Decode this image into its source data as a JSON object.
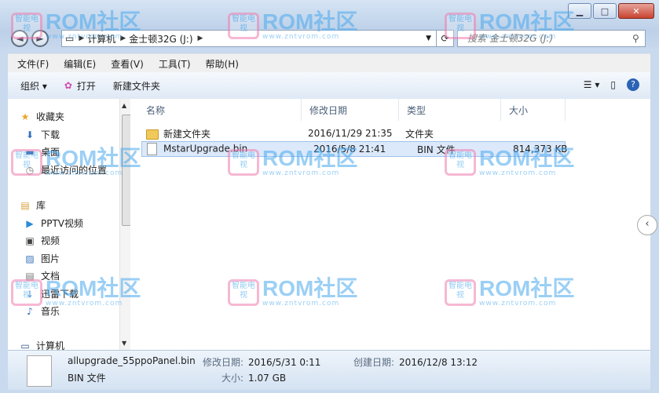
{
  "nav": {
    "back": "◄",
    "forward": "►"
  },
  "address": {
    "segments": [
      "计算机",
      "金士顿32G (J:)"
    ],
    "dropdown": "▼",
    "refresh": "⟳"
  },
  "search": {
    "placeholder": "搜索 金士顿32G (J:)"
  },
  "menu": [
    "文件(F)",
    "编辑(E)",
    "查看(V)",
    "工具(T)",
    "帮助(H)"
  ],
  "toolbar": {
    "organize": "组织 ▾",
    "open": "打开",
    "new_folder": "新建文件夹"
  },
  "sidebar": {
    "items": [
      {
        "label": "收藏夹",
        "icon": "★"
      },
      {
        "label": "下载",
        "icon": "⬇"
      },
      {
        "label": "桌面",
        "icon": "▬"
      },
      {
        "label": "最近访问的位置",
        "icon": "◷"
      },
      {
        "label": "库",
        "icon": "▤"
      },
      {
        "label": "PPTV视频",
        "icon": "▶"
      },
      {
        "label": "视频",
        "icon": "▣"
      },
      {
        "label": "图片",
        "icon": "▨"
      },
      {
        "label": "文档",
        "icon": "▤"
      },
      {
        "label": "迅雷下载",
        "icon": "↓"
      },
      {
        "label": "音乐",
        "icon": "♪"
      },
      {
        "label": "计算机",
        "icon": "▭"
      }
    ]
  },
  "columns": [
    "名称",
    "修改日期",
    "类型",
    "大小"
  ],
  "files": [
    {
      "name": "新建文件夹",
      "date": "2016/11/29 21:35",
      "type": "文件夹",
      "size": ""
    },
    {
      "name": "MstarUpgrade.bin",
      "date": "2016/5/8 21:41",
      "type": "BIN 文件",
      "size": "814,373 KB"
    }
  ],
  "details": {
    "filename": "allupgrade_55ppoPanel.bin",
    "filetype": "BIN 文件",
    "modified_label": "修改日期:",
    "modified": "2016/5/31 0:11",
    "size_label": "大小:",
    "size": "1.07 GB",
    "created_label": "创建日期:",
    "created": "2016/12/8 13:12"
  },
  "watermark": {
    "brand": "ROM社区",
    "domain": "www.zntvrom.com",
    "badge": "智能电视"
  }
}
